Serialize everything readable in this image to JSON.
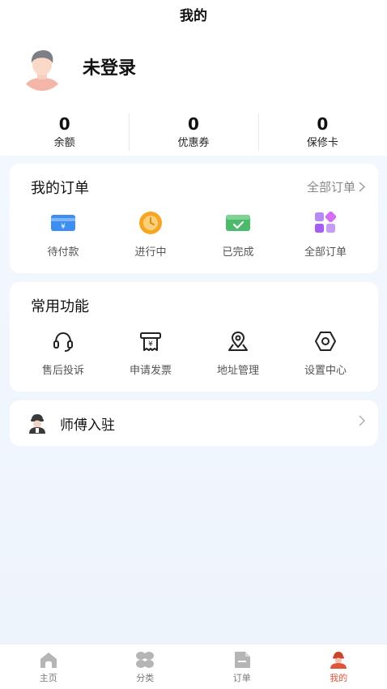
{
  "header": {
    "title": "我的"
  },
  "profile": {
    "username": "未登录",
    "avatar_icon": "user-avatar-icon"
  },
  "stats": [
    {
      "value": "0",
      "label": "余额"
    },
    {
      "value": "0",
      "label": "优惠券"
    },
    {
      "value": "0",
      "label": "保修卡"
    }
  ],
  "orders": {
    "title": "我的订单",
    "all_label": "全部订单",
    "items": [
      {
        "label": "待付款",
        "icon": "wallet-icon"
      },
      {
        "label": "进行中",
        "icon": "clock-icon"
      },
      {
        "label": "已完成",
        "icon": "check-card-icon"
      },
      {
        "label": "全部订单",
        "icon": "grid-apps-icon"
      }
    ]
  },
  "functions": {
    "title": "常用功能",
    "items": [
      {
        "label": "售后投诉",
        "icon": "headset-icon"
      },
      {
        "label": "申请发票",
        "icon": "invoice-icon"
      },
      {
        "label": "地址管理",
        "icon": "location-icon"
      },
      {
        "label": "设置中心",
        "icon": "settings-hex-icon"
      }
    ]
  },
  "partner": {
    "label": "师傅入驻",
    "icon": "technician-icon"
  },
  "tabbar": {
    "items": [
      {
        "label": "主页",
        "icon": "home-icon"
      },
      {
        "label": "分类",
        "icon": "category-icon"
      },
      {
        "label": "订单",
        "icon": "order-icon"
      },
      {
        "label": "我的",
        "icon": "profile-icon"
      }
    ],
    "active_index": 3
  },
  "colors": {
    "accent_active": "#e0553a",
    "order_blue": "#3d8ef0",
    "order_orange": "#f6a623",
    "order_green": "#4cba6b",
    "order_purple": "#a45ff0"
  }
}
